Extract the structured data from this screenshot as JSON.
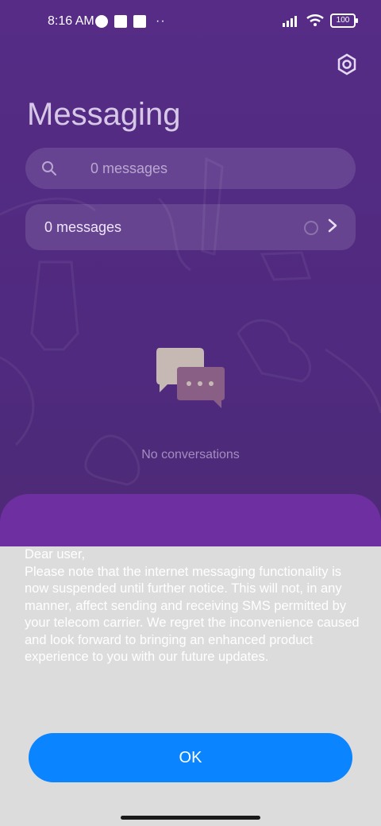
{
  "status_bar": {
    "time": "8:16 AM",
    "more": "··",
    "battery": "100"
  },
  "app": {
    "title": "Messaging"
  },
  "search": {
    "placeholder": "0 messages"
  },
  "summary_row": {
    "label": "0 messages"
  },
  "empty_state": {
    "text": "No conversations"
  },
  "dialog": {
    "message": "Dear user,\nPlease note that the internet messaging functionality is now suspended until further notice. This will not, in any manner, affect sending and receiving SMS permitted by your telecom carrier. We regret the inconvenience caused and look forward to bringing an enhanced product experience to you with our future updates.",
    "ok_label": "OK"
  },
  "icons": {
    "settings": "settings-hex-icon",
    "search": "search-icon",
    "chevron": "chevron-right-icon",
    "empty": "chat-bubbles-icon"
  },
  "colors": {
    "background": "#562c86",
    "sheet_top": "#6e2fa0",
    "sheet_body": "#dcdcdc",
    "ok_button": "#0b84ff"
  }
}
